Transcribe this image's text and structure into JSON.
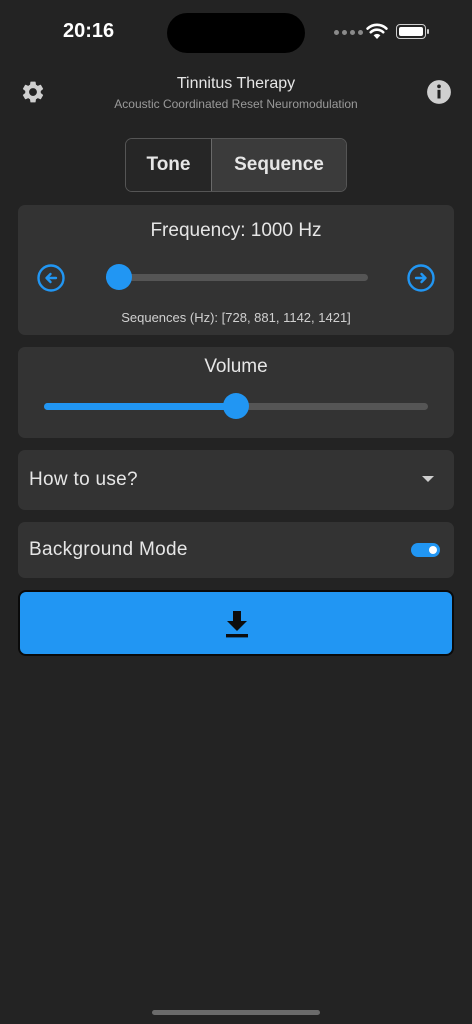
{
  "status_bar": {
    "time": "20:16",
    "icons": [
      "signal-dots-icon",
      "wifi-icon",
      "battery-icon"
    ]
  },
  "header": {
    "title": "Tinnitus Therapy",
    "subtitle": "Acoustic Coordinated Reset Neuromodulation",
    "left_icon": "gear-icon",
    "right_icon": "info-icon"
  },
  "mode_selector": {
    "options": [
      "Tone",
      "Sequence"
    ],
    "selected": "Sequence"
  },
  "frequency": {
    "label": "Frequency: 1000 Hz",
    "slider_value": 0.05,
    "sequences_label": "Sequences (Hz): [728, 881, 1142, 1421]",
    "left_icon": "arrow-left-circle-icon",
    "right_icon": "arrow-right-circle-icon"
  },
  "volume": {
    "label": "Volume",
    "slider_value": 0.5
  },
  "how_to_use": {
    "label": "How to use?",
    "icon": "dropdown-arrow-icon"
  },
  "background_mode": {
    "label": "Background Mode",
    "enabled": true
  },
  "download": {
    "icon": "download-icon"
  },
  "colors": {
    "accent": "#2196f3",
    "background": "#232323",
    "card": "#333333",
    "text": "#e6e6e6"
  }
}
